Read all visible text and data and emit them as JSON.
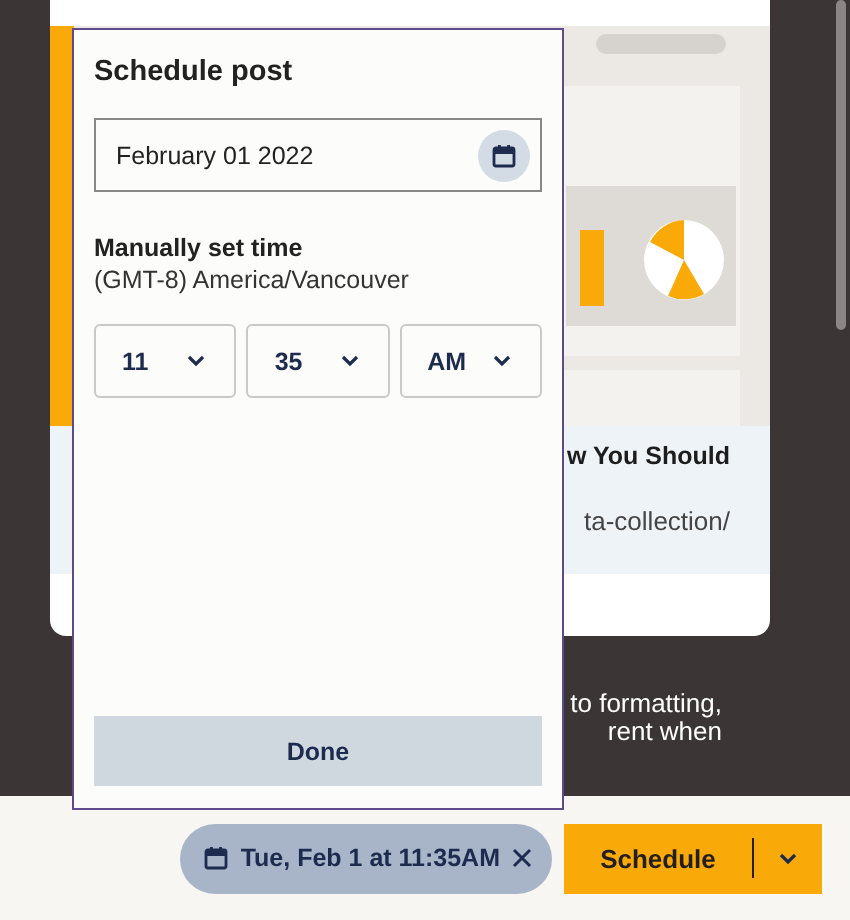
{
  "background_card": {
    "kind": "picture",
    "title_fragment": "w You Should",
    "url_fragment": "ta-collection/"
  },
  "background_text": [
    "to formatting,",
    "rent when"
  ],
  "schedule_popup": {
    "title": "Schedule post",
    "date_field": {
      "value": "February 01 2022"
    },
    "time_label": "Manually set time",
    "timezone": "(GMT-8) America/Vancouver",
    "time_selects": [
      {
        "value": "11"
      },
      {
        "value": "35"
      },
      {
        "value": "AM"
      }
    ],
    "done_button": "Done"
  },
  "footer": {
    "scheduled_chip": {
      "label": "Tue, Feb 1 at 11:35AM"
    },
    "schedule_button": "Schedule"
  }
}
